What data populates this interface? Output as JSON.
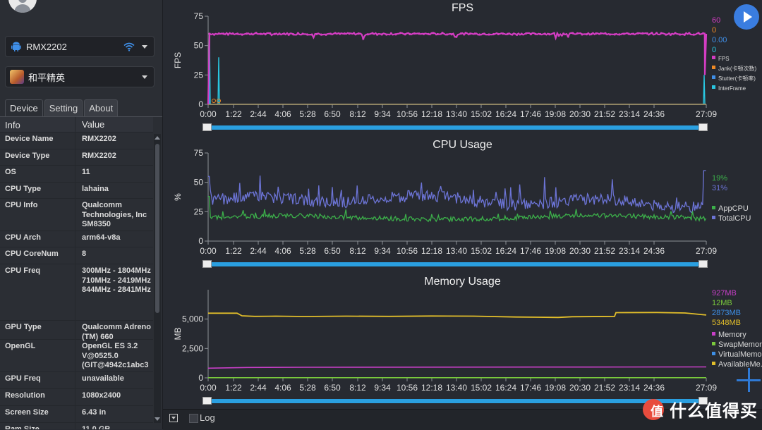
{
  "device_selector": {
    "label": "RMX2202",
    "icon": "android-icon"
  },
  "game_selector": {
    "label": "和平精英"
  },
  "tabs": [
    "Device",
    "Setting",
    "About"
  ],
  "info_table": {
    "header": [
      "Info",
      "Value"
    ],
    "rows": [
      {
        "k": "Device Name",
        "v": "RMX2202"
      },
      {
        "k": "Device Type",
        "v": "RMX2202"
      },
      {
        "k": "OS",
        "v": "11"
      },
      {
        "k": "CPU Type",
        "v": "lahaina"
      },
      {
        "k": "CPU Info",
        "v": "Qualcomm Technologies, Inc SM8350"
      },
      {
        "k": "CPU Arch",
        "v": "arm64-v8a"
      },
      {
        "k": "CPU CoreNum",
        "v": "8"
      },
      {
        "k": "CPU Freq",
        "v": "300MHz - 1804MHz 710MHz - 2419MHz 844MHz - 2841MHz"
      },
      {
        "k": "GPU Type",
        "v": "Qualcomm Adreno (TM) 660"
      },
      {
        "k": "OpenGL",
        "v": "OpenGL ES 3.2 V@0525.0 (GIT@4942c1abc3"
      },
      {
        "k": "GPU Freq",
        "v": "unavailable"
      },
      {
        "k": "Resolution",
        "v": "1080x2400"
      },
      {
        "k": "Screen Size",
        "v": "6.43 in"
      },
      {
        "k": "Ram Size",
        "v": "11.0 GB"
      }
    ]
  },
  "time_ticks": [
    "0:00",
    "1:22",
    "2:44",
    "4:06",
    "5:28",
    "6:50",
    "8:12",
    "9:34",
    "10:56",
    "12:18",
    "13:40",
    "15:02",
    "16:24",
    "17:46",
    "19:08",
    "20:30",
    "21:52",
    "23:14",
    "24:36",
    "27:09"
  ],
  "colors": {
    "fps": "#d33dc2",
    "jank": "#f08a24",
    "stutter": "#3f8fe8",
    "interframe": "#29c6e0",
    "appcpu": "#3cb04a",
    "totalcpu": "#6c74d6",
    "memory": "#c83fc8",
    "swap": "#79c93c",
    "virtual": "#3d8fe6",
    "available": "#e2be2a"
  },
  "chart_data": [
    {
      "type": "line",
      "title": "FPS",
      "ylabel": "FPS",
      "ylim": [
        0,
        75
      ],
      "yticks": [
        "75",
        "50",
        "25",
        "0"
      ],
      "current_values": [
        "60",
        "0",
        "0.00",
        "0"
      ],
      "series": [
        {
          "name": "FPS",
          "baseline": 60
        },
        {
          "name": "Jank(卡顿次数)",
          "baseline": 0
        },
        {
          "name": "Stutter(卡顿率)",
          "baseline": 0
        },
        {
          "name": "InterFrame",
          "baseline": 0
        }
      ],
      "legend": "right"
    },
    {
      "type": "line",
      "title": "CPU Usage",
      "ylabel": "%",
      "ylim": [
        0,
        75
      ],
      "yticks": [
        "75",
        "50",
        "25",
        "0"
      ],
      "current_values": [
        "19%",
        "31%"
      ],
      "series": [
        {
          "name": "AppCPU",
          "baseline": 19
        },
        {
          "name": "TotalCPU",
          "baseline": 33
        }
      ],
      "legend": "right"
    },
    {
      "type": "line",
      "title": "Memory Usage",
      "ylabel": "MB",
      "ylim": [
        0,
        7500
      ],
      "yticks": [
        "5,000",
        "2,500",
        "0"
      ],
      "current_values": [
        "927MB",
        "12MB",
        "2873MB",
        "5348MB"
      ],
      "series": [
        {
          "name": "Memory",
          "baseline": 927
        },
        {
          "name": "SwapMemory",
          "baseline": 12
        },
        {
          "name": "VirtualMemor",
          "baseline": 0
        },
        {
          "name": "AvailableMe...",
          "baseline": 5348
        }
      ],
      "legend": "right"
    }
  ],
  "bottom": {
    "log_label": "Log"
  },
  "watermark": {
    "logo_char": "值",
    "text": "什么值得买"
  }
}
